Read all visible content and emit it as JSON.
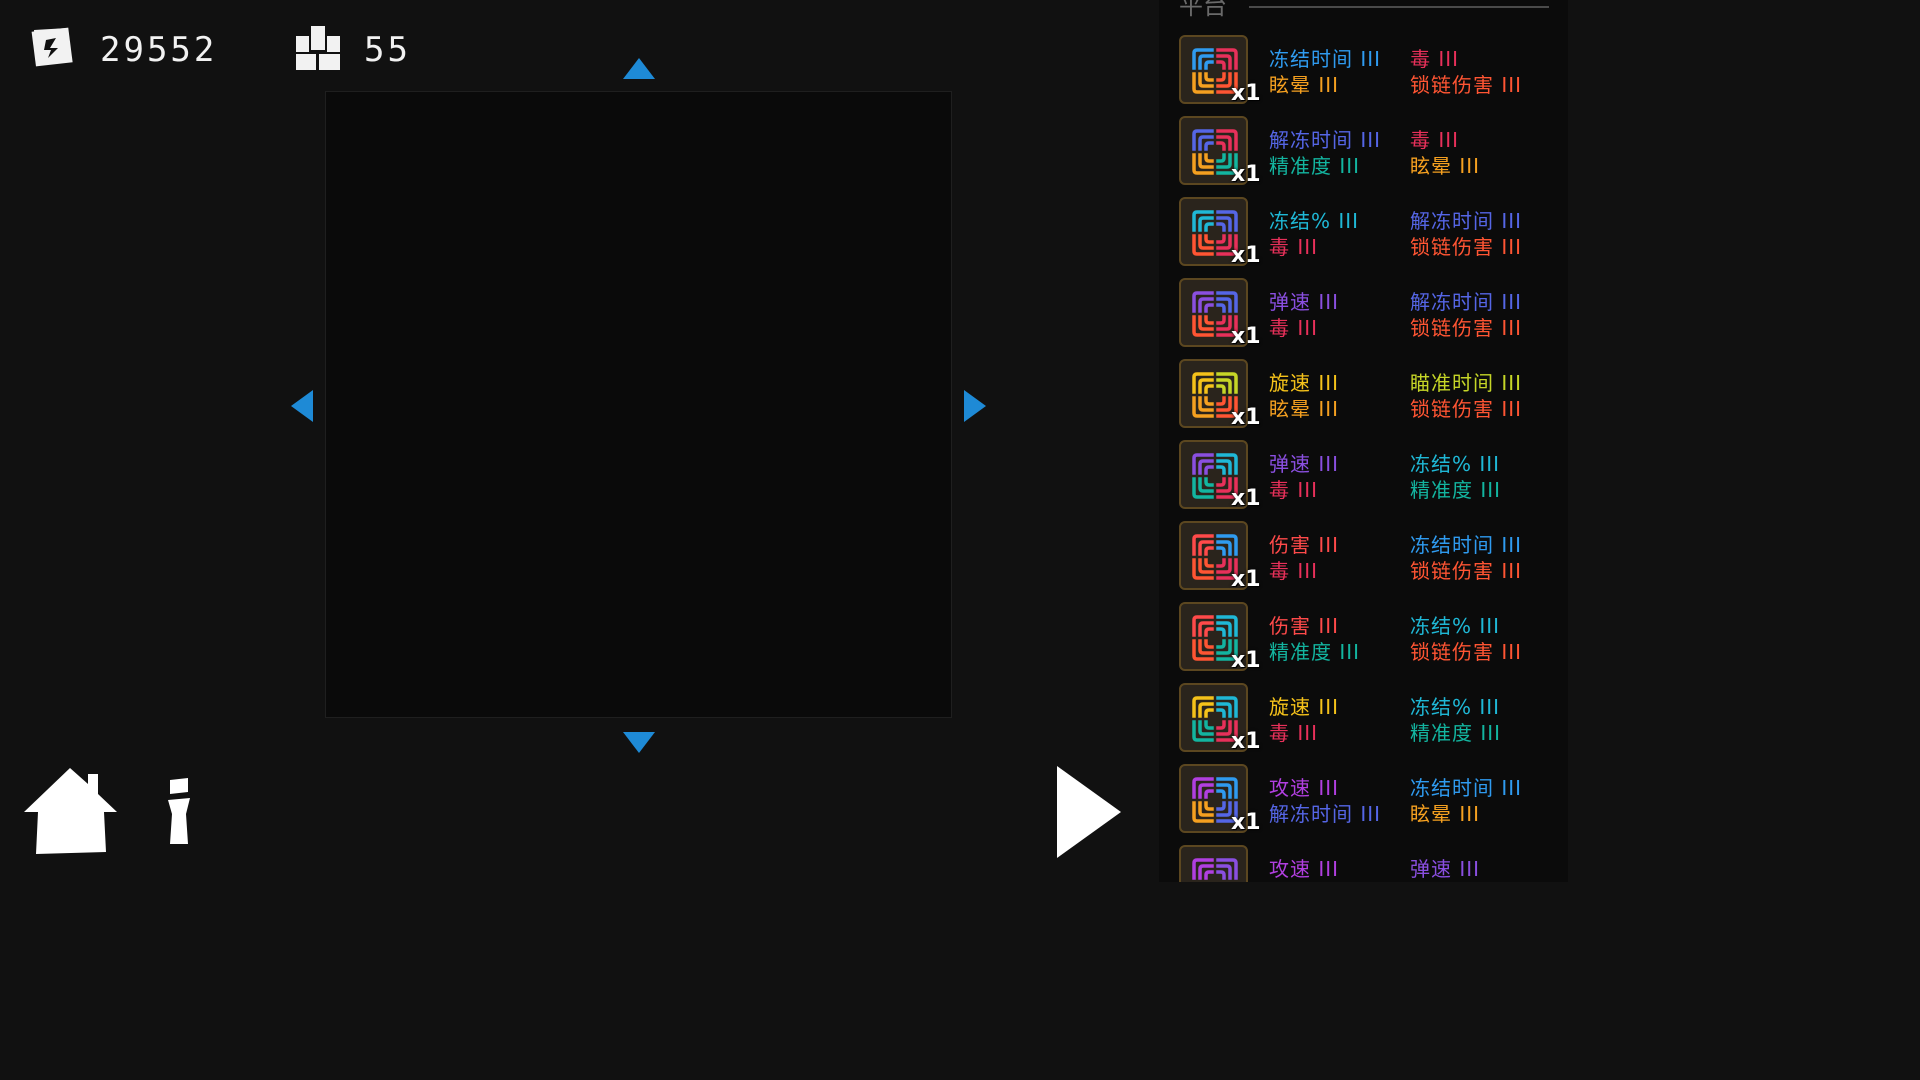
{
  "top": {
    "money": "29552",
    "bricks": "55"
  },
  "panel": {
    "title": "平台"
  },
  "colors": {
    "arrow": "#1e8ad6",
    "panel_bg": "#0b0b0b",
    "bg": "#111111"
  },
  "mod_colors": {
    "冻结时间": "#2f9bf0",
    "解冻时间": "#5566e6",
    "冻结%": "#1fb8d6",
    "毒": "#e8305a",
    "眩晕": "#f5a020",
    "锁链伤害": "#ff5533",
    "精准度": "#13b5a0",
    "弹速": "#8a4fe0",
    "旋速": "#f5c21a",
    "瞄准时间": "#c6d627",
    "伤害": "#ff4a4a",
    "攻速": "#b13fe0"
  },
  "towers": [
    {
      "count": "x1",
      "colors": [
        "#2f9bf0",
        "#e8305a",
        "#f5a020",
        "#ff5533"
      ],
      "mods": [
        "冻结时间 III",
        "毒 III",
        "眩晕 III",
        "锁链伤害 III"
      ],
      "mod_keys": [
        "冻结时间",
        "毒",
        "眩晕",
        "锁链伤害"
      ]
    },
    {
      "count": "x1",
      "colors": [
        "#5566e6",
        "#e8305a",
        "#f5a020",
        "#13b5a0"
      ],
      "mods": [
        "解冻时间 III",
        "毒 III",
        "精准度 III",
        "眩晕 III"
      ],
      "mod_keys": [
        "解冻时间",
        "毒",
        "精准度",
        "眩晕"
      ]
    },
    {
      "count": "x1",
      "colors": [
        "#1fb8d6",
        "#5566e6",
        "#ff5533",
        "#e8305a"
      ],
      "mods": [
        "冻结% III",
        "解冻时间 III",
        "毒 III",
        "锁链伤害 III"
      ],
      "mod_keys": [
        "冻结%",
        "解冻时间",
        "毒",
        "锁链伤害"
      ]
    },
    {
      "count": "x1",
      "colors": [
        "#8a4fe0",
        "#5566e6",
        "#ff5533",
        "#e8305a"
      ],
      "mods": [
        "弹速 III",
        "解冻时间 III",
        "毒 III",
        "锁链伤害 III"
      ],
      "mod_keys": [
        "弹速",
        "解冻时间",
        "毒",
        "锁链伤害"
      ]
    },
    {
      "count": "x1",
      "colors": [
        "#f5c21a",
        "#c6d627",
        "#f5a020",
        "#ff5533"
      ],
      "mods": [
        "旋速 III",
        "瞄准时间 III",
        "眩晕 III",
        "锁链伤害 III"
      ],
      "mod_keys": [
        "旋速",
        "瞄准时间",
        "眩晕",
        "锁链伤害"
      ]
    },
    {
      "count": "x1",
      "colors": [
        "#8a4fe0",
        "#1fb8d6",
        "#13b5a0",
        "#e8305a"
      ],
      "mods": [
        "弹速 III",
        "冻结% III",
        "毒 III",
        "精准度 III"
      ],
      "mod_keys": [
        "弹速",
        "冻结%",
        "毒",
        "精准度"
      ]
    },
    {
      "count": "x1",
      "colors": [
        "#ff4a4a",
        "#2f9bf0",
        "#ff5533",
        "#e8305a"
      ],
      "mods": [
        "伤害 III",
        "冻结时间 III",
        "毒 III",
        "锁链伤害 III"
      ],
      "mod_keys": [
        "伤害",
        "冻结时间",
        "毒",
        "锁链伤害"
      ]
    },
    {
      "count": "x1",
      "colors": [
        "#ff4a4a",
        "#1fb8d6",
        "#ff5533",
        "#13b5a0"
      ],
      "mods": [
        "伤害 III",
        "冻结% III",
        "精准度 III",
        "锁链伤害 III"
      ],
      "mod_keys": [
        "伤害",
        "冻结%",
        "精准度",
        "锁链伤害"
      ]
    },
    {
      "count": "x1",
      "colors": [
        "#f5c21a",
        "#1fb8d6",
        "#13b5a0",
        "#e8305a"
      ],
      "mods": [
        "旋速 III",
        "冻结% III",
        "毒 III",
        "精准度 III"
      ],
      "mod_keys": [
        "旋速",
        "冻结%",
        "毒",
        "精准度"
      ]
    },
    {
      "count": "x1",
      "colors": [
        "#b13fe0",
        "#2f9bf0",
        "#f5a020",
        "#5566e6"
      ],
      "mods": [
        "攻速 III",
        "冻结时间 III",
        "解冻时间 III",
        "眩晕 III"
      ],
      "mod_keys": [
        "攻速",
        "冻结时间",
        "解冻时间",
        "眩晕"
      ]
    },
    {
      "count": "",
      "colors": [
        "#b13fe0",
        "#8a4fe0",
        "#13b5a0",
        "#8a4fe0"
      ],
      "mods": [
        "攻速 III",
        "弹速 III",
        "",
        ""
      ],
      "mod_keys": [
        "攻速",
        "弹速",
        "",
        ""
      ]
    }
  ]
}
